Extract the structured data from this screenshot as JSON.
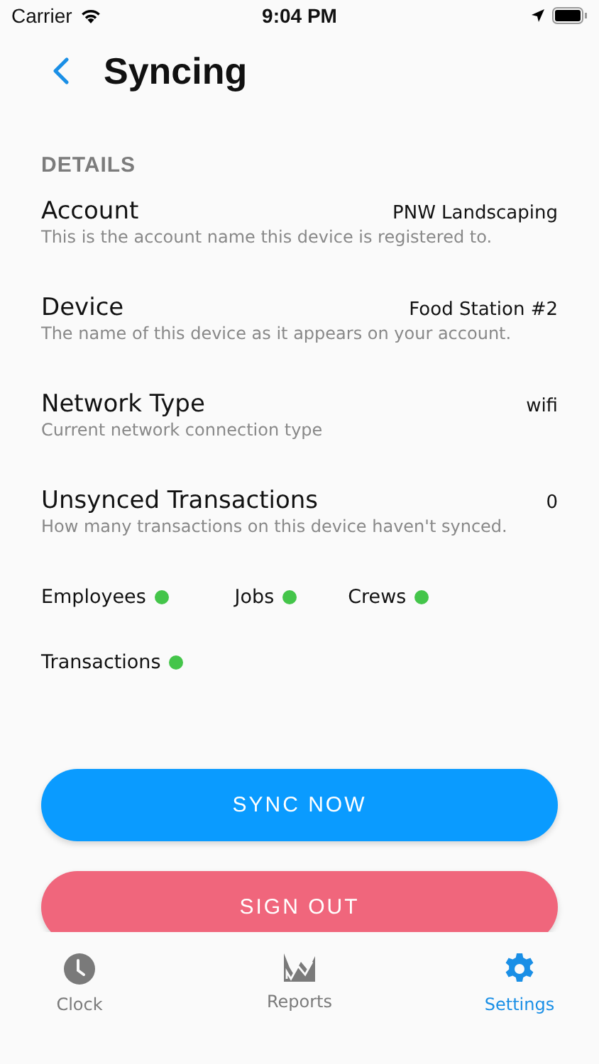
{
  "status_bar": {
    "carrier": "Carrier",
    "time": "9:04 PM"
  },
  "header": {
    "title": "Syncing"
  },
  "section": {
    "title": "DETAILS"
  },
  "details": [
    {
      "label": "Account",
      "value": "PNW Landscaping",
      "description": "This is the account name this device is registered to."
    },
    {
      "label": "Device",
      "value": "Food Station #2",
      "description": "The name of this device as it appears on your account."
    },
    {
      "label": "Network Type",
      "value": "wifi",
      "description": "Current network connection type"
    },
    {
      "label": "Unsynced Transactions",
      "value": "0",
      "description": "How many transactions on this device haven't synced."
    }
  ],
  "sync_status": [
    {
      "label": "Employees",
      "color": "#44c54a"
    },
    {
      "label": "Jobs",
      "color": "#44c54a"
    },
    {
      "label": "Crews",
      "color": "#44c54a"
    },
    {
      "label": "Transactions",
      "color": "#44c54a"
    }
  ],
  "buttons": [
    {
      "kind": "primary",
      "label": "SYNC NOW"
    },
    {
      "kind": "danger",
      "label": "SIGN OUT"
    }
  ],
  "tabs": [
    {
      "kind": "clock",
      "label": "Clock",
      "selected": false
    },
    {
      "kind": "reports",
      "label": "Reports",
      "selected": false
    },
    {
      "kind": "settings",
      "label": "Settings",
      "selected": true
    }
  ]
}
